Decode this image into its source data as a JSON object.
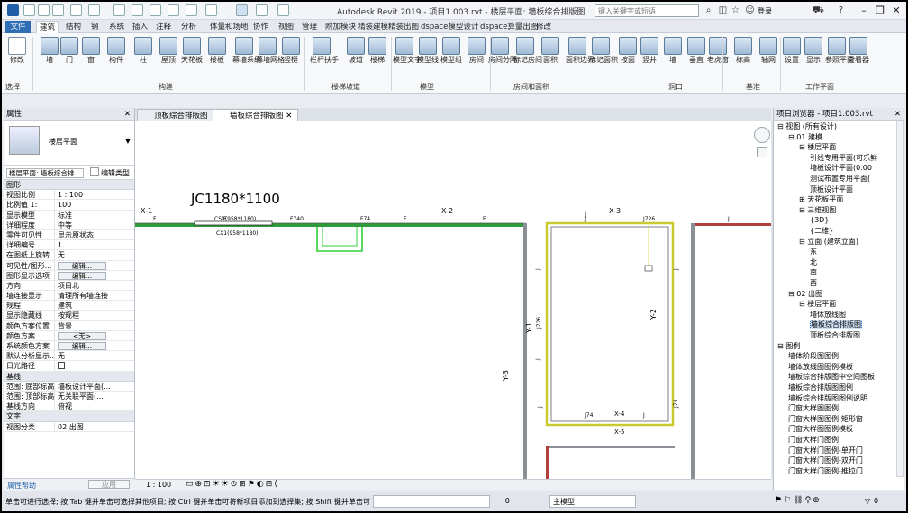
{
  "app": {
    "title": "Autodesk Revit 2019 - 项目1.003.rvt - 楼层平面: 墙板综合排版图",
    "search_placeholder": "键入关键字或短语",
    "login": "登录"
  },
  "tabs": [
    "文件",
    "建筑",
    "结构",
    "钢",
    "系统",
    "插入",
    "注释",
    "分析",
    "体量和场地",
    "协作",
    "视图",
    "管理",
    "附加模块",
    "精装建模",
    "精装出图",
    "dspace模型设计",
    "dspace算量出图",
    "修改"
  ],
  "ribbon": {
    "buttons": [
      "修改",
      "墙",
      "门",
      "窗",
      "构件",
      "柱",
      "屋顶",
      "天花板",
      "楼板",
      "幕墙系统",
      "幕墙网格",
      "竖梃",
      "栏杆扶手",
      "坡道",
      "楼梯",
      "模型文字",
      "模型线",
      "模型组",
      "房间",
      "房间分隔",
      "标记房间",
      "面积",
      "面积边界",
      "标记面积",
      "按面",
      "竖井",
      "墙",
      "垂直",
      "老虎窗",
      "标高",
      "轴网",
      "设置",
      "显示",
      "参照平面",
      "查看器"
    ],
    "panels": [
      "选择",
      "构建",
      "楼梯坡道",
      "模型",
      "房间和面积",
      "洞口",
      "基准",
      "工作平面"
    ]
  },
  "properties": {
    "title": "属性",
    "type_name": "楼层平面",
    "instance_selector": "楼层平面: 墙板综合排",
    "edit_type": "编辑类型",
    "rows": [
      {
        "cat": "图形"
      },
      {
        "k": "视图比例",
        "v": "1 : 100"
      },
      {
        "k": "比例值 1:",
        "v": "100"
      },
      {
        "k": "显示模型",
        "v": "标准"
      },
      {
        "k": "详细程度",
        "v": "中等"
      },
      {
        "k": "零件可见性",
        "v": "显示原状态"
      },
      {
        "k": "详细编号",
        "v": "1"
      },
      {
        "k": "在图纸上旋转",
        "v": "无"
      },
      {
        "k": "可见性/图形...",
        "v": "编辑...",
        "btn": true
      },
      {
        "k": "图形显示选项",
        "v": "编辑...",
        "btn": true
      },
      {
        "k": "方向",
        "v": "项目北"
      },
      {
        "k": "墙连接显示",
        "v": "清理所有墙连接"
      },
      {
        "k": "规程",
        "v": "建筑"
      },
      {
        "k": "显示隐藏线",
        "v": "按规程"
      },
      {
        "k": "颜色方案位置",
        "v": "背景"
      },
      {
        "k": "颜色方案",
        "v": "<无>",
        "btn": true
      },
      {
        "k": "系统颜色方案",
        "v": "编辑...",
        "btn": true
      },
      {
        "k": "默认分析显示...",
        "v": "无"
      },
      {
        "k": "日光路径",
        "v": "",
        "check": true
      },
      {
        "cat": "基线"
      },
      {
        "k": "范围: 底部标高",
        "v": "墙板设计平面(..."
      },
      {
        "k": "范围: 顶部标高",
        "v": "无关联平面(..."
      },
      {
        "k": "基线方向",
        "v": "俯视"
      },
      {
        "cat": "文字"
      },
      {
        "k": "视图分类",
        "v": "02 出图"
      }
    ],
    "help": "属性帮助",
    "apply": "应用"
  },
  "view_tabs": [
    {
      "label": "顶板综合排版图",
      "active": false
    },
    {
      "label": "墙板综合排版图",
      "active": true
    }
  ],
  "view_control": {
    "scale": "1 : 100"
  },
  "canvas": {
    "title": "JC1180*1100",
    "labels": [
      "X-1",
      "X-2",
      "X-3",
      "X-4",
      "X-5",
      "Y-1",
      "Y-2",
      "Y-3",
      "CS1(958*1180)",
      "CX1(958*1180)",
      "F",
      "F",
      "F",
      "F",
      "F740",
      "F74",
      "J",
      "J726",
      "J",
      "J",
      "J",
      "J",
      "J74",
      "J74",
      "J",
      "J",
      "J726",
      "J",
      "A"
    ]
  },
  "browser": {
    "title": "项目浏览器 - 项目1.003.rvt",
    "nodes": [
      {
        "t": "视图 (所有设计)",
        "d": 0,
        "tog": "−"
      },
      {
        "t": "01 建模",
        "d": 1,
        "tog": "−"
      },
      {
        "t": "楼层平面",
        "d": 2,
        "tog": "−"
      },
      {
        "t": "引线专用平面(可乐鲜",
        "d": 3
      },
      {
        "t": "墙板设计平面(0.00",
        "d": 3
      },
      {
        "t": "测试布置专用平面(",
        "d": 3
      },
      {
        "t": "顶板设计平面",
        "d": 3
      },
      {
        "t": "天花板平面",
        "d": 2,
        "tog": "+"
      },
      {
        "t": "三维视图",
        "d": 2,
        "tog": "−"
      },
      {
        "t": "{3D}",
        "d": 3
      },
      {
        "t": "{二维}",
        "d": 3
      },
      {
        "t": "立面 (建筑立面)",
        "d": 2,
        "tog": "−"
      },
      {
        "t": "东",
        "d": 3
      },
      {
        "t": "北",
        "d": 3
      },
      {
        "t": "南",
        "d": 3
      },
      {
        "t": "西",
        "d": 3
      },
      {
        "t": "02 出图",
        "d": 1,
        "tog": "−"
      },
      {
        "t": "楼层平面",
        "d": 2,
        "tog": "−"
      },
      {
        "t": "墙体放线图",
        "d": 3
      },
      {
        "t": "墙板综合排版图",
        "d": 3,
        "sel": true
      },
      {
        "t": "顶板综合排版图",
        "d": 3
      },
      {
        "t": "图例",
        "d": 0,
        "tog": "−"
      },
      {
        "t": "墙体阶段图图例",
        "d": 1
      },
      {
        "t": "墙体放线图图例模板",
        "d": 1
      },
      {
        "t": "墙板综合排版图中空间图板",
        "d": 1
      },
      {
        "t": "墙板综合排版图图例",
        "d": 1
      },
      {
        "t": "墙板综合排版图图例说明",
        "d": 1
      },
      {
        "t": "门窗大样图图例",
        "d": 1
      },
      {
        "t": "门窗大样图图例-矩形窗",
        "d": 1
      },
      {
        "t": "门窗大样图图例模板",
        "d": 1
      },
      {
        "t": "门窗大样门图例",
        "d": 1
      },
      {
        "t": "门窗大样门图例-单开门",
        "d": 1
      },
      {
        "t": "门窗大样门图例-双开门",
        "d": 1
      },
      {
        "t": "门窗大样门图例-推拉门",
        "d": 1
      }
    ]
  },
  "status": {
    "text": "单击可进行选择; 按 Tab 键并单击可选择其他项目; 按 Ctrl 键并单击可将新项目添加到选择集; 按 Shift 键并单击可",
    "zero": ":0",
    "model": "主模型",
    "filter": "0"
  }
}
